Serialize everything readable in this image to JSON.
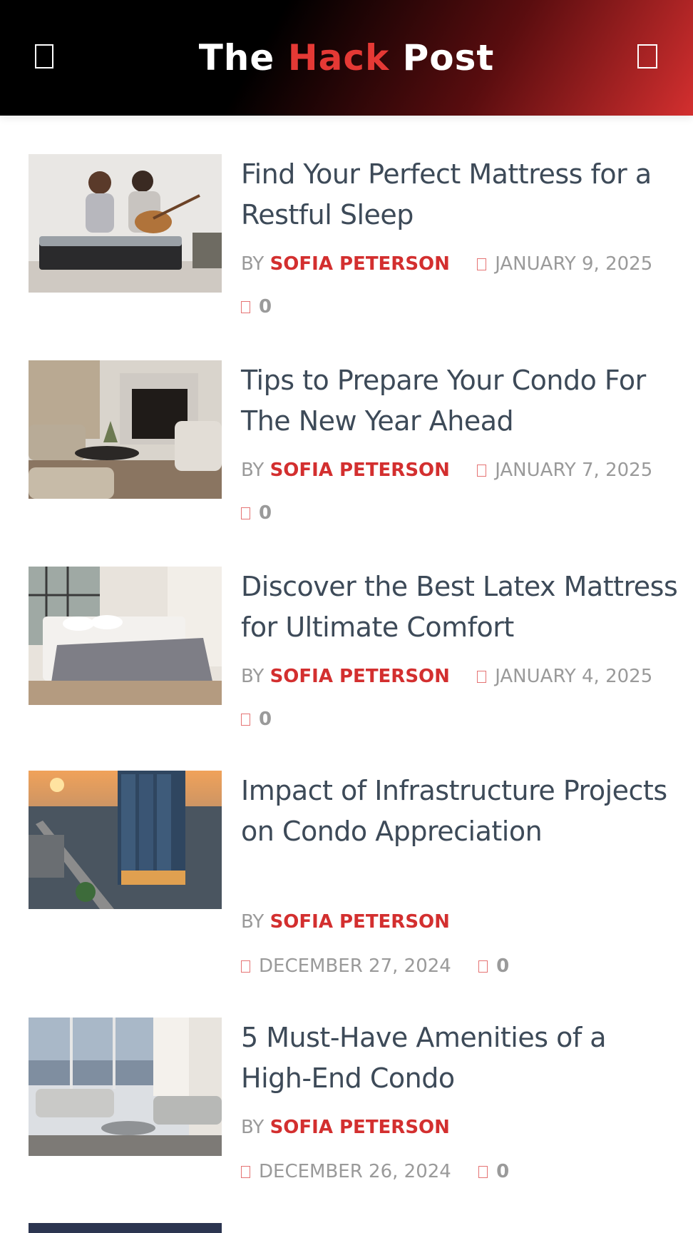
{
  "site": {
    "logo_part1": "The ",
    "logo_part2": "Hack",
    "logo_part3": " Post"
  },
  "header": {
    "menu_icon": "menu-icon",
    "search_icon": "search-icon"
  },
  "colors": {
    "accent": "#d32f2f",
    "title": "#3d4a58",
    "meta": "#9a9a9a"
  },
  "posts": [
    {
      "title": "Find Your Perfect Mattress for a Restful Sleep",
      "by": "BY",
      "author": "SOFIA PETERSON",
      "date": "JANUARY 9, 2025",
      "comments": "0",
      "image": "couple-on-mattress-photo"
    },
    {
      "title": "Tips to Prepare Your Condo For The New Year Ahead",
      "by": "BY",
      "author": "SOFIA PETERSON",
      "date": "JANUARY 7, 2025",
      "comments": "0",
      "image": "living-room-fireplace-photo"
    },
    {
      "title": "Discover the Best Latex Mattress for Ultimate Comfort",
      "by": "BY",
      "author": "SOFIA PETERSON",
      "date": "JANUARY 4, 2025",
      "comments": "0",
      "image": "bedroom-photo"
    },
    {
      "title": "Impact of Infrastructure Projects on Condo Appreciation",
      "by": "BY",
      "author": "SOFIA PETERSON",
      "date": "DECEMBER 27, 2024",
      "comments": "0",
      "image": "city-tower-sunset-photo"
    },
    {
      "title": "5 Must-Have Amenities of a High-End Condo",
      "by": "BY",
      "author": "SOFIA PETERSON",
      "date": "DECEMBER 26, 2024",
      "comments": "0",
      "image": "condo-living-room-photo"
    }
  ]
}
